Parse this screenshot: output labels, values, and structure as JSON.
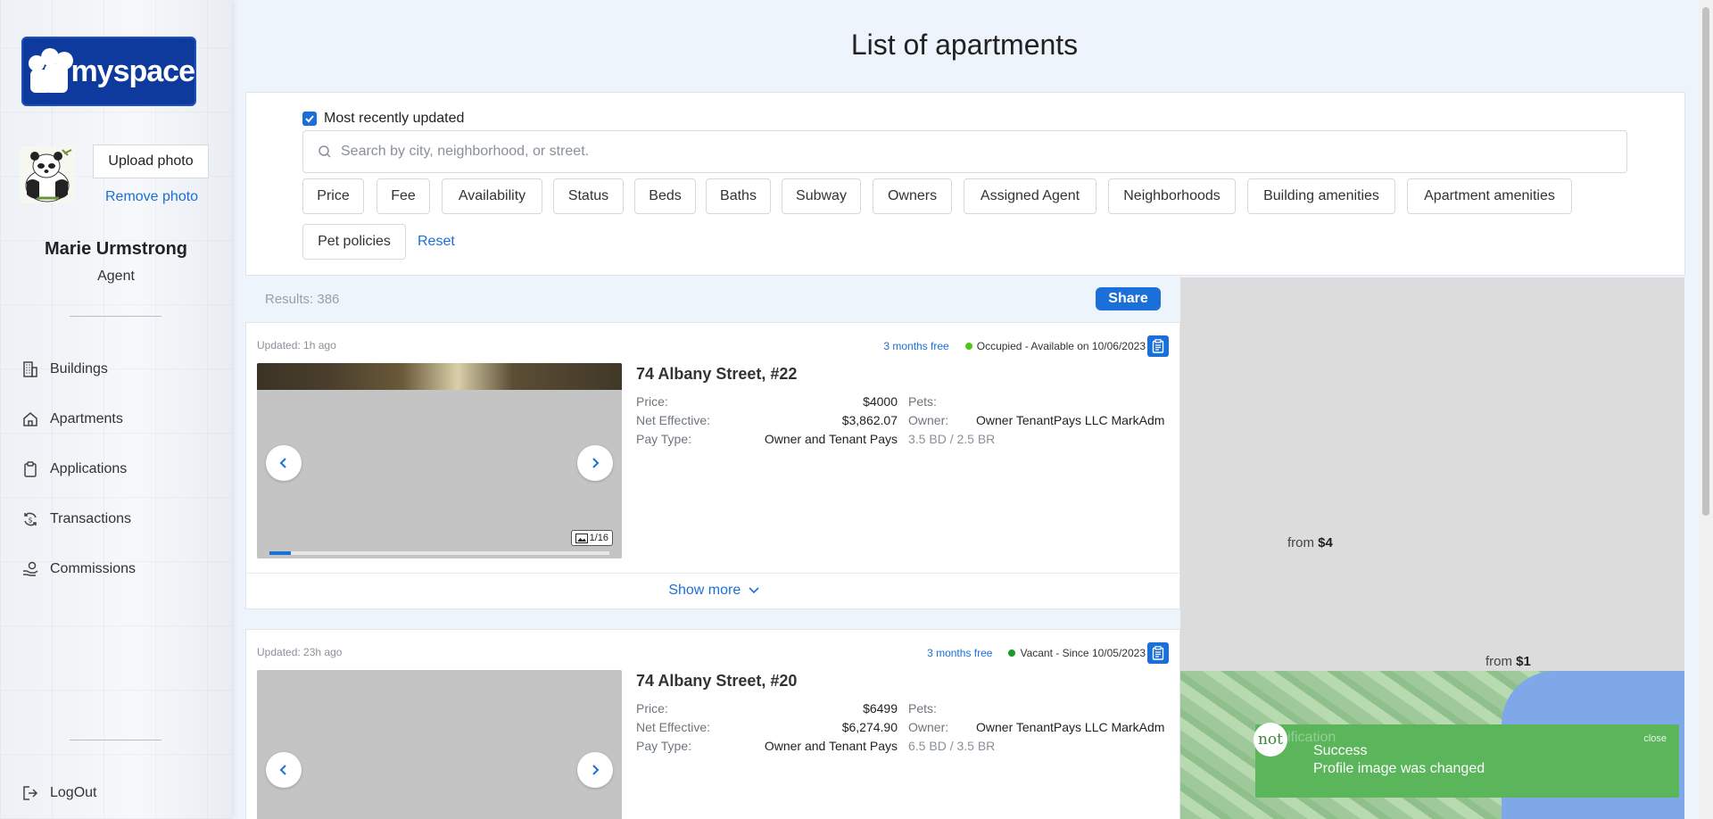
{
  "sidebar": {
    "logo_text": "myspace",
    "upload_label": "Upload photo",
    "remove_label": "Remove photo",
    "user_name": "Marie Urmstrong",
    "user_role": "Agent",
    "nav": [
      {
        "label": "Buildings",
        "icon": "building-icon"
      },
      {
        "label": "Apartments",
        "icon": "home-icon"
      },
      {
        "label": "Applications",
        "icon": "clipboard-icon"
      },
      {
        "label": "Transactions",
        "icon": "exchange-icon"
      },
      {
        "label": "Commissions",
        "icon": "hand-coin-icon"
      }
    ],
    "logout_label": "LogOut"
  },
  "main": {
    "title": "List of apartments",
    "checkbox_label": "Most recently updated",
    "checkbox_checked": true,
    "search_placeholder": "Search by city, neighborhood, or street.",
    "filters": [
      "Price",
      "Fee",
      "Availability",
      "Status",
      "Beds",
      "Baths",
      "Subway",
      "Owners",
      "Assigned Agent",
      "Neighborhoods",
      "Building amenities",
      "Apartment amenities",
      "Pet policies"
    ],
    "reset_label": "Reset",
    "results_text": "Results: 386",
    "share_label": "Share"
  },
  "listings": [
    {
      "updated": "Updated: 1h ago",
      "promo": "3 months free",
      "status": "Occupied - Available on 10/06/2023",
      "status_color": "#52c41a",
      "title": "74 Albany Street, #22",
      "price_label": "Price:",
      "price": "$4000",
      "net_label": "Net Effective:",
      "net": "$3,862.07",
      "pay_label": "Pay Type:",
      "pay": "Owner and Tenant Pays",
      "pets_label": "Pets:",
      "owner_label": "Owner:",
      "owner": "Owner TenantPays LLC MarkAdm",
      "beds": "3.5 BD / 2.5 BR",
      "photo_count": "1/16",
      "photo_progress": 0.0625,
      "show_more": "Show more"
    },
    {
      "updated": "Updated: 23h ago",
      "promo": "3 months free",
      "status": "Vacant - Since 10/05/2023",
      "status_color": "#1a9a2a",
      "title": "74 Albany Street, #20",
      "price_label": "Price:",
      "price": "$6499",
      "net_label": "Net Effective:",
      "net": "$6,274.90",
      "pay_label": "Pay Type:",
      "pay": "Owner and Tenant Pays",
      "pets_label": "Pets:",
      "owner_label": "Owner:",
      "owner": "Owner TenantPays LLC MarkAdm",
      "beds": "6.5 BD / 3.5 BR"
    }
  ],
  "map": {
    "markers": [
      {
        "prefix": "from",
        "value": "$4"
      },
      {
        "prefix": "from",
        "value": "$1"
      }
    ]
  },
  "toast": {
    "badge": "not",
    "badge_ghost": "ification",
    "close_label": "close",
    "title": "Success",
    "message": "Profile image was changed"
  }
}
